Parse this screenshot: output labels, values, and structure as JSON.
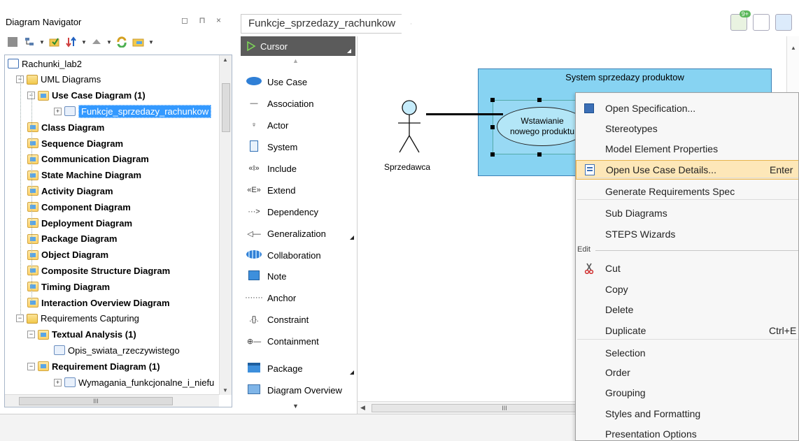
{
  "navigator": {
    "title": "Diagram Navigator",
    "controls": "◻ ⊓ ×",
    "tree": [
      {
        "label": "Rachunki_lab2",
        "bold": false,
        "level": 0,
        "type": "proj",
        "expander": ""
      },
      {
        "label": "UML Diagrams",
        "bold": false,
        "level": 1,
        "type": "folder",
        "expander": "−"
      },
      {
        "label": "Use Case Diagram (1)",
        "bold": true,
        "level": 2,
        "type": "diag",
        "expander": "−"
      },
      {
        "label": "Funkcje_sprzedazy_rachunkow",
        "bold": false,
        "level": 3,
        "type": "doc",
        "expander": "+",
        "selected": true
      },
      {
        "label": "Class Diagram",
        "bold": true,
        "level": 2,
        "type": "diag",
        "expander": ""
      },
      {
        "label": "Sequence Diagram",
        "bold": true,
        "level": 2,
        "type": "diag",
        "expander": ""
      },
      {
        "label": "Communication Diagram",
        "bold": true,
        "level": 2,
        "type": "diag",
        "expander": ""
      },
      {
        "label": "State Machine Diagram",
        "bold": true,
        "level": 2,
        "type": "diag",
        "expander": ""
      },
      {
        "label": "Activity Diagram",
        "bold": true,
        "level": 2,
        "type": "diag",
        "expander": ""
      },
      {
        "label": "Component Diagram",
        "bold": true,
        "level": 2,
        "type": "diag",
        "expander": ""
      },
      {
        "label": "Deployment Diagram",
        "bold": true,
        "level": 2,
        "type": "diag",
        "expander": ""
      },
      {
        "label": "Package Diagram",
        "bold": true,
        "level": 2,
        "type": "diag",
        "expander": ""
      },
      {
        "label": "Object Diagram",
        "bold": true,
        "level": 2,
        "type": "diag",
        "expander": ""
      },
      {
        "label": "Composite Structure Diagram",
        "bold": true,
        "level": 2,
        "type": "diag",
        "expander": ""
      },
      {
        "label": "Timing Diagram",
        "bold": true,
        "level": 2,
        "type": "diag",
        "expander": ""
      },
      {
        "label": "Interaction Overview Diagram",
        "bold": true,
        "level": 2,
        "type": "diag",
        "expander": ""
      },
      {
        "label": "Requirements Capturing",
        "bold": false,
        "level": 1,
        "type": "folder",
        "expander": "−"
      },
      {
        "label": "Textual Analysis (1)",
        "bold": true,
        "level": 2,
        "type": "diag",
        "expander": "−"
      },
      {
        "label": "Opis_swiata_rzeczywistego",
        "bold": false,
        "level": 3,
        "type": "doc",
        "expander": ""
      },
      {
        "label": "Requirement Diagram (1)",
        "bold": true,
        "level": 2,
        "type": "diag",
        "expander": "−"
      },
      {
        "label": "Wymagania_funkcjonalne_i_niefu",
        "bold": false,
        "level": 3,
        "type": "doc",
        "expander": "+"
      }
    ],
    "hscroll_grip": "III"
  },
  "diagram": {
    "breadcrumb": "Funkcje_sprzedazy_rachunkow",
    "notification_badge": "9+"
  },
  "palette": {
    "cursor": "Cursor",
    "items": [
      {
        "label": "Use Case",
        "glyph": "usecase"
      },
      {
        "label": "Association",
        "glyph": "—"
      },
      {
        "label": "Actor",
        "glyph": "♀"
      },
      {
        "label": "System",
        "glyph": "sys"
      },
      {
        "label": "Include",
        "glyph": "«I»"
      },
      {
        "label": "Extend",
        "glyph": "«E»"
      },
      {
        "label": "Dependency",
        "glyph": "···>"
      },
      {
        "label": "Generalization",
        "glyph": "◁—"
      },
      {
        "label": "Collaboration",
        "glyph": "collab"
      },
      {
        "label": "Note",
        "glyph": "note"
      },
      {
        "label": "Anchor",
        "glyph": "·······"
      },
      {
        "label": "Constraint",
        "glyph": ".{}."
      },
      {
        "label": "Containment",
        "glyph": "⊕—"
      },
      {
        "label": "Package",
        "glyph": "pkg"
      },
      {
        "label": "Diagram Overview",
        "glyph": "ov"
      }
    ]
  },
  "canvas": {
    "system_title": "System sprzedazy produktow",
    "usecase_line1": "Wstawianie",
    "usecase_line2": "nowego produktu",
    "actor_label": "Sprzedawca",
    "hscroll_grip": "III"
  },
  "context_menu": {
    "items": [
      {
        "label": "Open Specification...",
        "shortcut": "",
        "icon": "spec"
      },
      {
        "label": "Stereotypes",
        "shortcut": ""
      },
      {
        "label": "Model Element Properties",
        "shortcut": ""
      },
      {
        "label": "Open Use Case Details...",
        "shortcut": "Enter",
        "icon": "details",
        "highlighted": true
      },
      {
        "label": "Generate Requirements Spec",
        "shortcut": ""
      },
      {
        "label": "Sub Diagrams",
        "shortcut": ""
      },
      {
        "label": "STEPS Wizards",
        "shortcut": ""
      },
      {
        "label": "Cut",
        "shortcut": "",
        "icon": "cut"
      },
      {
        "label": "Copy",
        "shortcut": ""
      },
      {
        "label": "Delete",
        "shortcut": ""
      },
      {
        "label": "Duplicate",
        "shortcut": "Ctrl+E"
      },
      {
        "label": "Selection",
        "shortcut": ""
      },
      {
        "label": "Order",
        "shortcut": ""
      },
      {
        "label": "Grouping",
        "shortcut": ""
      },
      {
        "label": "Styles and Formatting",
        "shortcut": ""
      },
      {
        "label": "Presentation Options",
        "shortcut": ""
      }
    ],
    "group_edit": "Edit"
  }
}
